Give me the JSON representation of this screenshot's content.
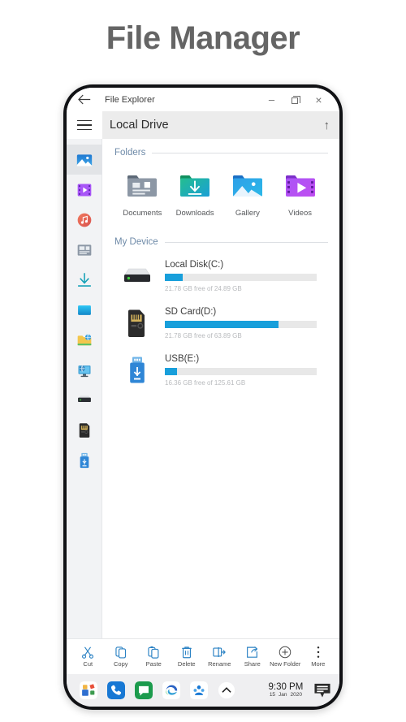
{
  "page": {
    "title": "File Manager"
  },
  "window": {
    "titlebar": {
      "back_icon": "back-arrow-icon",
      "title": "File Explorer",
      "minimize_label": "–",
      "restore_icon": "restore-window-icon",
      "close_label": "×"
    },
    "address": {
      "menu_icon": "hamburger-menu-icon",
      "path": "Local Drive",
      "up_label": "↑"
    }
  },
  "sidebar": {
    "items": [
      {
        "name": "gallery",
        "icon": "gallery-icon",
        "active": true
      },
      {
        "name": "videos",
        "icon": "video-icon",
        "active": false
      },
      {
        "name": "music",
        "icon": "music-icon",
        "active": false
      },
      {
        "name": "documents",
        "icon": "document-icon",
        "active": false
      },
      {
        "name": "downloads",
        "icon": "download-icon",
        "active": false
      },
      {
        "name": "apps",
        "icon": "apps-icon",
        "active": false
      },
      {
        "name": "network-folder",
        "icon": "network-folder-icon",
        "active": false
      },
      {
        "name": "network-pc",
        "icon": "network-computer-icon",
        "active": false
      },
      {
        "name": "local-disk",
        "icon": "hard-drive-icon",
        "active": false
      },
      {
        "name": "sd-card",
        "icon": "sd-card-icon",
        "active": false
      },
      {
        "name": "usb-drive",
        "icon": "usb-drive-icon",
        "active": false
      }
    ]
  },
  "main": {
    "folders_section": {
      "title": "Folders",
      "items": [
        {
          "label": "Documents",
          "icon": "documents-folder-icon"
        },
        {
          "label": "Downloads",
          "icon": "downloads-folder-icon"
        },
        {
          "label": "Gallery",
          "icon": "gallery-folder-icon"
        },
        {
          "label": "Videos",
          "icon": "videos-folder-icon"
        }
      ]
    },
    "device_section": {
      "title": "My Device",
      "drives": [
        {
          "name": "Local Disk(C:)",
          "icon": "hard-drive-icon",
          "detail": "21.78 GB free of 24.89 GB",
          "used_percent": 12
        },
        {
          "name": "SD Card(D:)",
          "icon": "sd-card-icon",
          "detail": "21.78 GB free of 63.89 GB",
          "used_percent": 75
        },
        {
          "name": "USB(E:)",
          "icon": "usb-drive-icon",
          "detail": "16.36 GB free of 125.61 GB",
          "used_percent": 8
        }
      ]
    }
  },
  "toolbar": {
    "items": [
      {
        "label": "Cut",
        "icon": "scissors-icon"
      },
      {
        "label": "Copy",
        "icon": "copy-icon"
      },
      {
        "label": "Paste",
        "icon": "paste-icon"
      },
      {
        "label": "Delete",
        "icon": "trash-icon"
      },
      {
        "label": "Rename",
        "icon": "rename-icon"
      },
      {
        "label": "Share",
        "icon": "share-icon"
      },
      {
        "label": "New Folder",
        "icon": "plus-circle-icon"
      },
      {
        "label": "More",
        "icon": "more-vertical-icon"
      }
    ]
  },
  "taskbar": {
    "apps": [
      {
        "name": "start",
        "icon": "start-apps-icon"
      },
      {
        "name": "phone",
        "icon": "phone-icon"
      },
      {
        "name": "messages",
        "icon": "message-icon"
      },
      {
        "name": "edge",
        "icon": "edge-browser-icon"
      },
      {
        "name": "contacts",
        "icon": "contacts-icon"
      },
      {
        "name": "show-hidden",
        "icon": "chevron-up-icon"
      }
    ],
    "clock": {
      "time": "9:30 PM",
      "day": "15",
      "month": "Jan",
      "year": "2020"
    },
    "notification_icon": "notification-icon"
  },
  "colors": {
    "accent": "#189fdb",
    "section_title": "#6e8aa8",
    "title_gray": "#656565"
  }
}
